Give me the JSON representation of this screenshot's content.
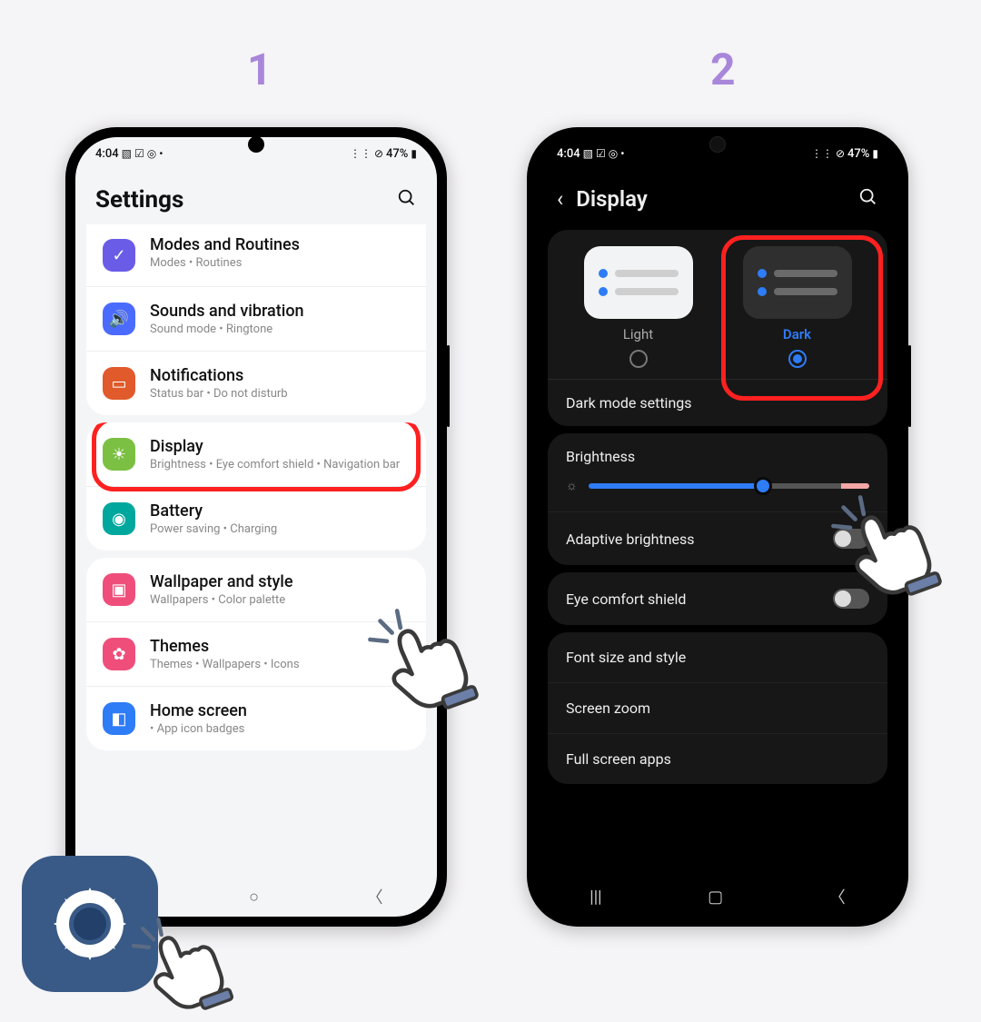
{
  "steps": {
    "one": "1",
    "two": "2"
  },
  "status": {
    "time": "4:04",
    "battery": "47%"
  },
  "phone1": {
    "title": "Settings",
    "items": {
      "modes": {
        "title": "Modes and Routines",
        "sub": "Modes  •  Routines"
      },
      "sounds": {
        "title": "Sounds and vibration",
        "sub": "Sound mode  •  Ringtone"
      },
      "notif": {
        "title": "Notifications",
        "sub": "Status bar  •  Do not disturb"
      },
      "display": {
        "title": "Display",
        "sub": "Brightness  •  Eye comfort shield  •  Navigation bar"
      },
      "battery": {
        "title": "Battery",
        "sub": "Power saving  •  Charging"
      },
      "wall": {
        "title": "Wallpaper and style",
        "sub": "Wallpapers  •  Color palette"
      },
      "themes": {
        "title": "Themes",
        "sub": "Themes  •  Wallpapers  •  Icons"
      },
      "home": {
        "title": "Home screen",
        "sub": "  •  App icon badges"
      }
    }
  },
  "phone2": {
    "title": "Display",
    "light": "Light",
    "dark": "Dark",
    "dms": "Dark mode settings",
    "brightness": "Brightness",
    "adaptive": "Adaptive brightness",
    "eye": "Eye comfort shield",
    "font": "Font size and style",
    "zoom": "Screen zoom",
    "full": "Full screen apps"
  }
}
